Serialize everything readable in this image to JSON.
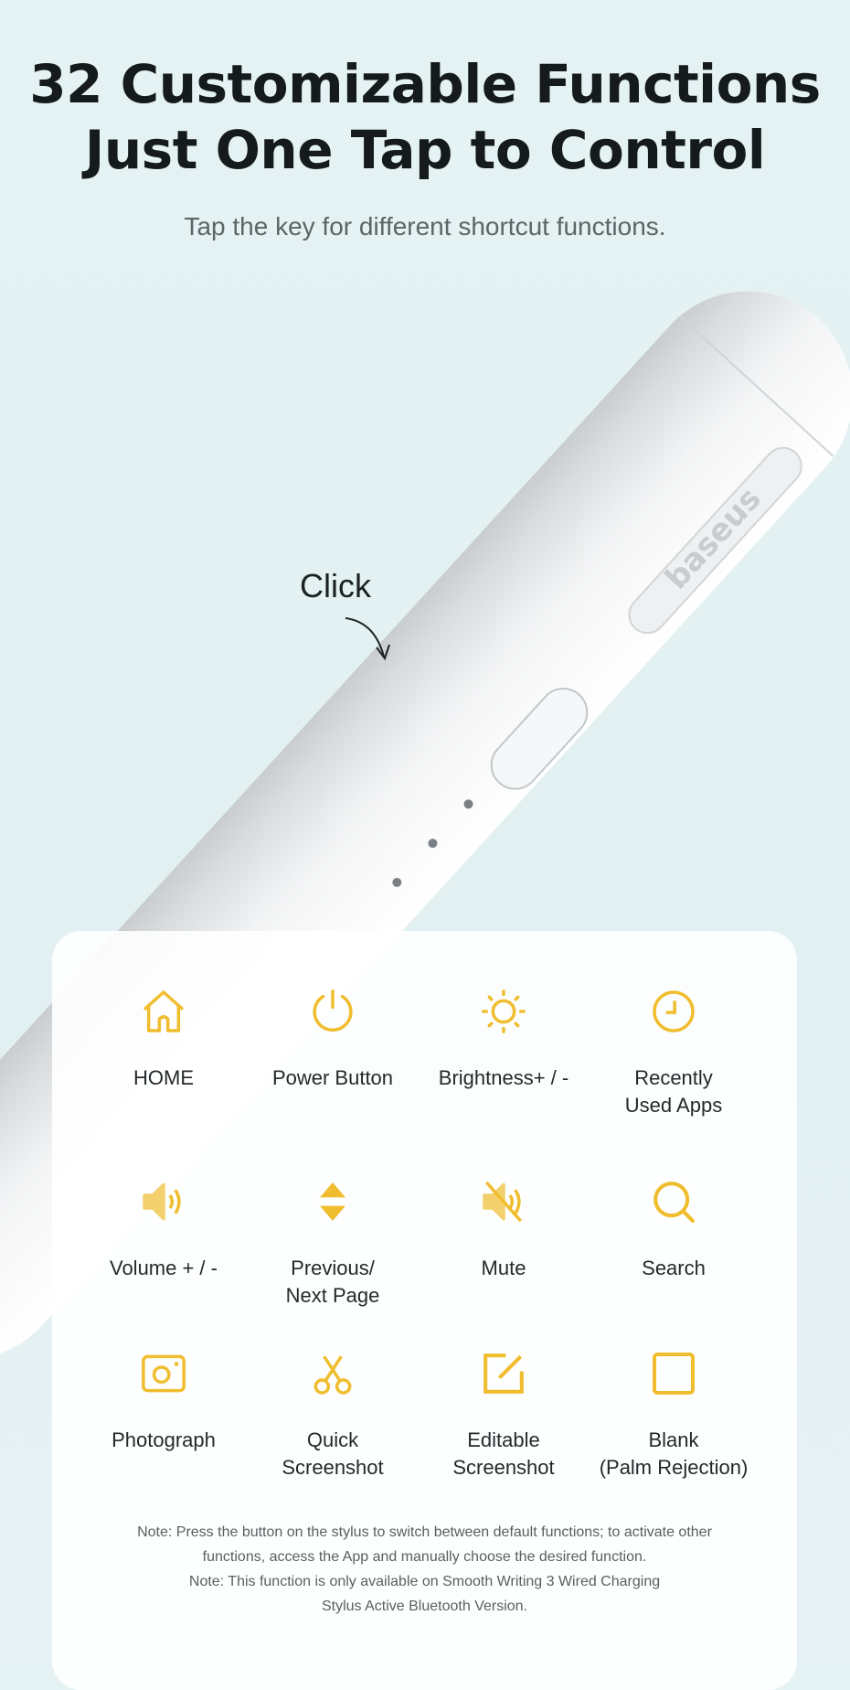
{
  "header": {
    "title_line1": "32 Customizable Functions",
    "title_line2": "Just One Tap to Control",
    "subtitle": "Tap the key for different shortcut functions."
  },
  "product": {
    "brand_logo": "baseus",
    "callout": "Click"
  },
  "colors": {
    "icon": "#f0bd2e",
    "background": "#e3f1f3"
  },
  "functions": [
    {
      "icon": "home-icon",
      "label": "HOME"
    },
    {
      "icon": "power-icon",
      "label": "Power Button"
    },
    {
      "icon": "brightness-icon",
      "label": "Brightness+ / -"
    },
    {
      "icon": "clock-icon",
      "label": "Recently\nUsed Apps"
    },
    {
      "icon": "volume-icon",
      "label": "Volume + / -"
    },
    {
      "icon": "up-down-arrows-icon",
      "label": "Previous/\nNext Page"
    },
    {
      "icon": "mute-icon",
      "label": "Mute"
    },
    {
      "icon": "search-icon",
      "label": "Search"
    },
    {
      "icon": "camera-icon",
      "label": "Photograph"
    },
    {
      "icon": "scissors-icon",
      "label": "Quick\nScreenshot"
    },
    {
      "icon": "edit-icon",
      "label": "Editable\nScreenshot"
    },
    {
      "icon": "blank-square-icon",
      "label": "Blank\n(Palm Rejection)"
    }
  ],
  "notes": [
    "Note: Press the button on the stylus to switch between default functions; to activate other",
    "functions, access the App and manually choose the desired function.",
    "Note: This function is only available on Smooth Writing 3 Wired Charging",
    "Stylus Active Bluetooth Version."
  ]
}
